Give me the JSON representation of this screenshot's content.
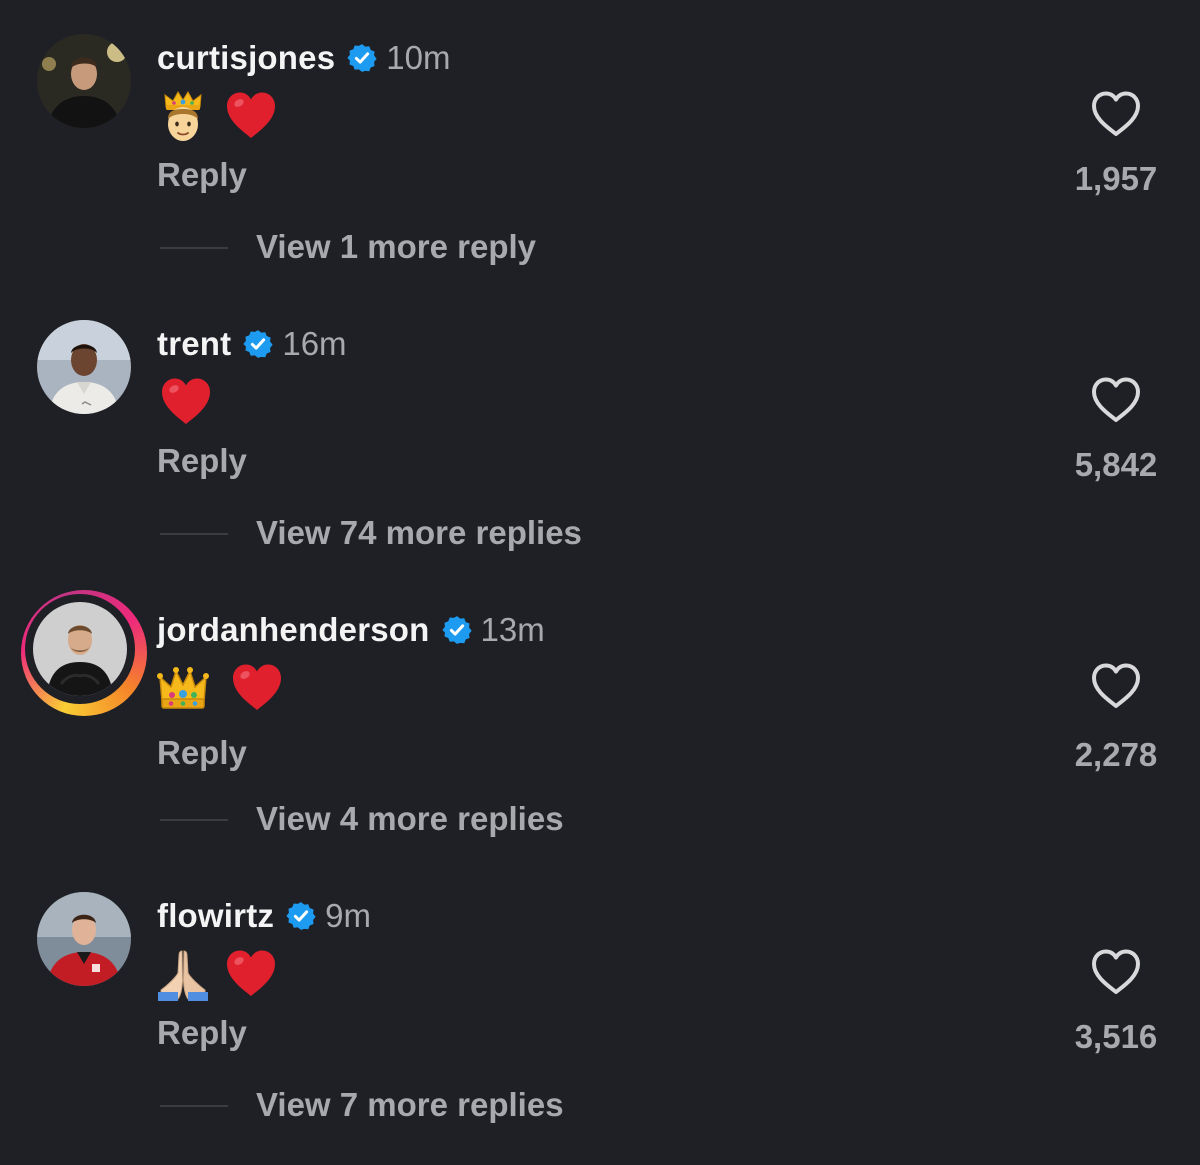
{
  "colors": {
    "background": "#1f2026",
    "text_primary": "#f4f4f5",
    "text_secondary": "#a8a9ae",
    "verified_blue": "#1d9bf0",
    "heart_red": "#e0202d"
  },
  "comments": [
    {
      "username": "curtisjones",
      "verified": true,
      "time": "10m",
      "emojis": [
        "prince",
        "red-heart"
      ],
      "reply_label": "Reply",
      "likes": "1,957",
      "view_replies": "View 1 more reply",
      "has_story_ring": false
    },
    {
      "username": "trent",
      "verified": true,
      "time": "16m",
      "emojis": [
        "red-heart"
      ],
      "reply_label": "Reply",
      "likes": "5,842",
      "view_replies": "View 74 more replies",
      "has_story_ring": false
    },
    {
      "username": "jordanhenderson",
      "verified": true,
      "time": "13m",
      "emojis": [
        "crown",
        "red-heart"
      ],
      "reply_label": "Reply",
      "likes": "2,278",
      "view_replies": "View 4 more replies",
      "has_story_ring": true
    },
    {
      "username": "flowirtz",
      "verified": true,
      "time": "9m",
      "emojis": [
        "folded-hands",
        "red-heart"
      ],
      "reply_label": "Reply",
      "likes": "3,516",
      "view_replies": "View 7 more replies",
      "has_story_ring": false
    }
  ]
}
